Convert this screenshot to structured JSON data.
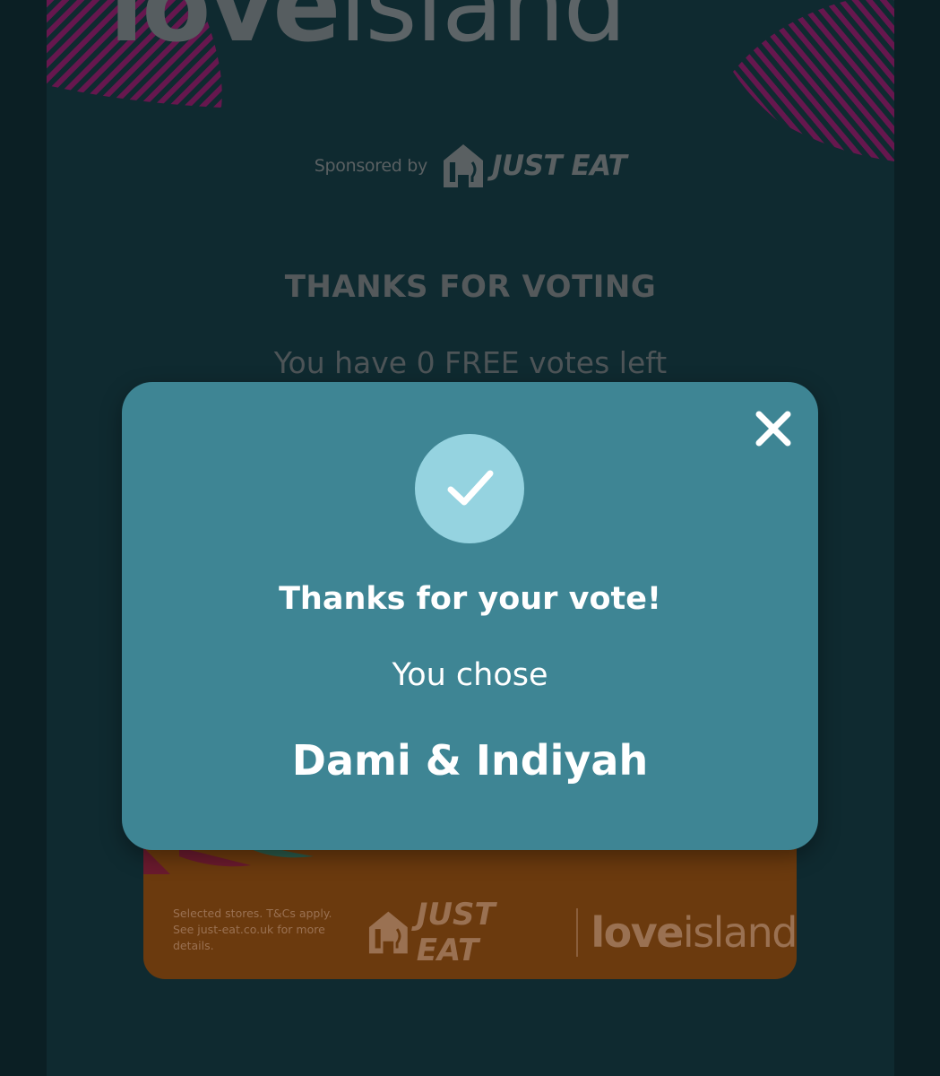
{
  "header": {
    "logo_part1": "love",
    "logo_part2": "island"
  },
  "sponsor": {
    "label": "Sponsored by",
    "brand": "JUST EAT"
  },
  "voting": {
    "heading": "THANKS FOR VOTING",
    "votes_left": "You have 0 FREE votes left"
  },
  "promo": {
    "terms": "Selected stores. T&Cs apply. See just-eat.co.uk for more details.",
    "brand1": "JUST EAT",
    "brand2_bold": "love",
    "brand2_light": "island"
  },
  "modal": {
    "title": "Thanks for your vote!",
    "subtitle": "You chose",
    "choice": "Dami & Indiyah",
    "close_icon": "close-icon",
    "check_icon": "checkmark-icon"
  },
  "colors": {
    "background": "#0f2a30",
    "modal": "#3e8594",
    "check_circle": "#95d3e0",
    "promo_card": "#6b3a0e",
    "leaf_magenta": "#7a1a5c"
  }
}
